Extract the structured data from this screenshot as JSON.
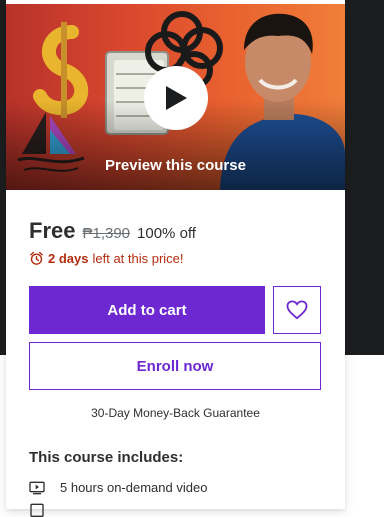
{
  "preview": {
    "label": "Preview this course"
  },
  "pricing": {
    "current": "Free",
    "original": "₱1,390",
    "discount": "100% off"
  },
  "timer": {
    "bold": "2 days",
    "rest": "left at this price!",
    "icon": "alarm-clock-icon"
  },
  "actions": {
    "add_to_cart": "Add to cart",
    "wishlist_icon": "heart-icon",
    "enroll": "Enroll now"
  },
  "guarantee": "30-Day Money-Back Guarantee",
  "includes": {
    "title": "This course includes:",
    "items": [
      {
        "icon": "video-icon",
        "label": "5 hours on-demand video"
      }
    ]
  },
  "colors": {
    "brand_purple": "#6d28d2",
    "timer_red": "#b32d0f"
  }
}
